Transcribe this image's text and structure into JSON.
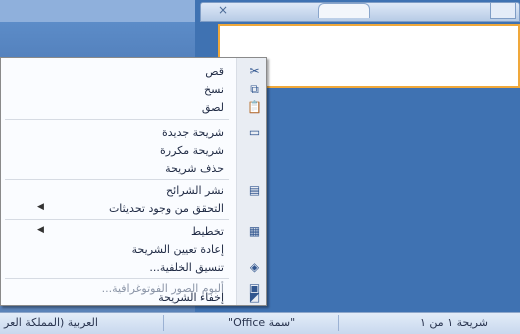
{
  "tabs": {
    "close_glyph": "×"
  },
  "menu": {
    "items": [
      {
        "id": "cut",
        "label": "قص",
        "icon": "scissors-icon",
        "glyph": "✂",
        "disabled": false,
        "submenu": false
      },
      {
        "id": "copy",
        "label": "نسخ",
        "icon": "copy-icon",
        "glyph": "⧉",
        "disabled": false,
        "submenu": false
      },
      {
        "id": "paste",
        "label": "لصق",
        "icon": "paste-icon",
        "glyph": "📋",
        "disabled": false,
        "submenu": false
      },
      {
        "id": "new-slide",
        "label": "شريحة جديدة",
        "icon": "new-slide-icon",
        "glyph": "▭",
        "disabled": false,
        "submenu": false
      },
      {
        "id": "duplicate-slide",
        "label": "شريحة مكررة",
        "icon": "",
        "glyph": "",
        "disabled": false,
        "submenu": false
      },
      {
        "id": "delete-slide",
        "label": "حذف شريحة",
        "icon": "",
        "glyph": "",
        "disabled": false,
        "submenu": false
      },
      {
        "id": "publish-slides",
        "label": "نشر الشرائح",
        "icon": "publish-slides-icon",
        "glyph": "▤",
        "disabled": false,
        "submenu": false
      },
      {
        "id": "check-updates",
        "label": "التحقق من وجود تحديثات",
        "icon": "",
        "glyph": "",
        "disabled": false,
        "submenu": true
      },
      {
        "id": "layout",
        "label": "تخطيط",
        "icon": "layout-icon",
        "glyph": "▦",
        "disabled": false,
        "submenu": true
      },
      {
        "id": "reset-slide",
        "label": "إعادة تعيين الشريحة",
        "icon": "",
        "glyph": "",
        "disabled": false,
        "submenu": false
      },
      {
        "id": "format-background",
        "label": "تنسيق الخلفية...",
        "icon": "format-background-icon",
        "glyph": "◈",
        "disabled": false,
        "submenu": false
      },
      {
        "id": "photo-album",
        "label": "ألبوم الصور الفوتوغرافية...",
        "icon": "photo-album-icon",
        "glyph": "▣",
        "disabled": true,
        "submenu": false
      },
      {
        "id": "hide-slide",
        "label": "إخفاء الشريحة",
        "icon": "hide-slide-icon",
        "glyph": "◩",
        "disabled": false,
        "submenu": false
      }
    ]
  },
  "status": {
    "slide": "شريحة ١ من ١",
    "theme": "\"سمة Office\"",
    "language": "العربية (المملكة العر"
  }
}
